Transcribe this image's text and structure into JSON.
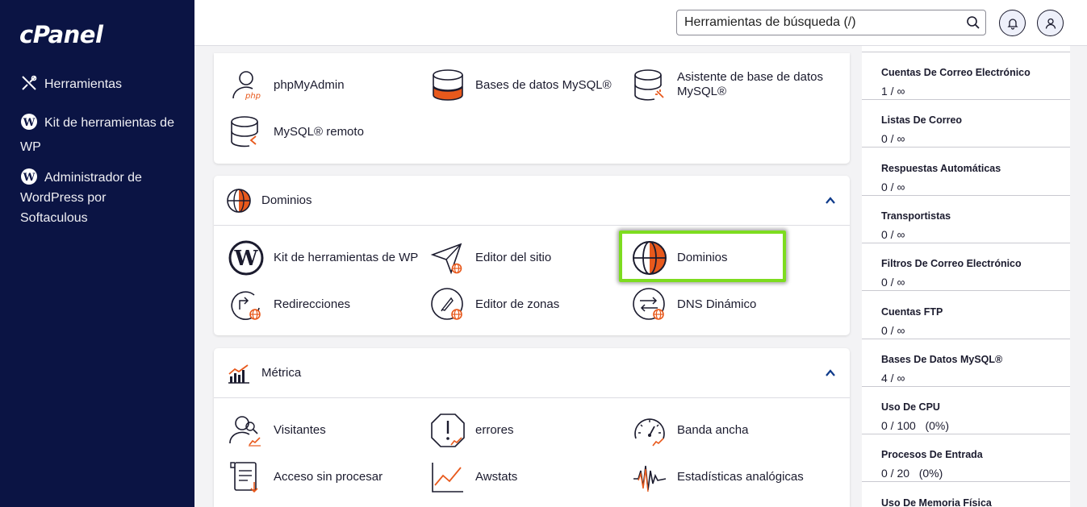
{
  "sidebar": {
    "logo": "cPanel",
    "items": [
      {
        "label": "Herramientas",
        "icon": "tools-icon"
      },
      {
        "label": "Kit de herramientas de WP",
        "icon": "wordpress-icon"
      },
      {
        "label": "Administrador de WordPress por Softaculous",
        "icon": "wordpress-icon"
      }
    ]
  },
  "header": {
    "search_placeholder": "Herramientas de búsqueda (/)"
  },
  "databases_card": {
    "tools": [
      "phpMyAdmin",
      "Bases de datos MySQL®",
      "Asistente de base de datos MySQL®",
      "MySQL® remoto"
    ]
  },
  "domains_card": {
    "title": "Dominios",
    "tools": [
      "Kit de herramientas de WP",
      "Editor del sitio",
      "Dominios",
      "Redirecciones",
      "Editor de zonas",
      "DNS Dinámico"
    ]
  },
  "metrics_card": {
    "title": "Métrica",
    "tools": [
      "Visitantes",
      "errores",
      "Banda ancha",
      "Acceso sin procesar",
      "Awstats",
      "Estadísticas analógicas"
    ]
  },
  "stats": [
    {
      "label": "Cuentas De Correo Electrónico",
      "value": "1 / ∞"
    },
    {
      "label": "Listas De Correo",
      "value": "0 / ∞"
    },
    {
      "label": "Respuestas Automáticas",
      "value": "0 / ∞"
    },
    {
      "label": "Transportistas",
      "value": "0 / ∞"
    },
    {
      "label": "Filtros De Correo Electrónico",
      "value": "0 / ∞"
    },
    {
      "label": "Cuentas FTP",
      "value": "0 / ∞"
    },
    {
      "label": "Bases De Datos MySQL®",
      "value": "4 / ∞"
    },
    {
      "label": "Uso De CPU",
      "value": "0 / 100   (0%)"
    },
    {
      "label": "Procesos De Entrada",
      "value": "0 / 20   (0%)"
    },
    {
      "label": "Uso De Memoria Física",
      "value": ""
    }
  ],
  "colors": {
    "sidebar_bg": "#0b1444",
    "accent_orange": "#e8591c",
    "highlight_green": "#7ddc1f"
  }
}
